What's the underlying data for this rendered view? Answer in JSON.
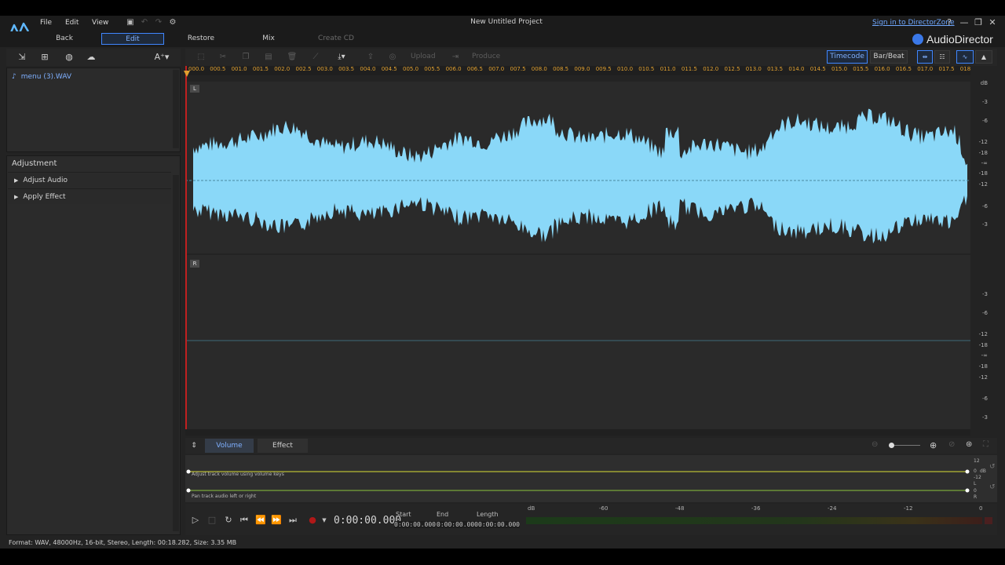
{
  "window": {
    "title": "New Untitled Project",
    "sign_in": "Sign in to DirectorZone",
    "help": "?",
    "minimize": "—",
    "restore": "❐",
    "close": "✕"
  },
  "menu": {
    "file": "File",
    "edit": "Edit",
    "view": "View"
  },
  "modes": {
    "back": "Back",
    "edit": "Edit",
    "restore": "Restore",
    "mix": "Mix",
    "create_cd": "Create CD"
  },
  "brand": {
    "name": "AudioDirector"
  },
  "left_toolbar": {
    "text_tool": "A⁺▾"
  },
  "media": {
    "items": [
      {
        "name": "menu (3).WAV"
      }
    ]
  },
  "adjustment": {
    "title": "Adjustment",
    "rows": [
      {
        "label": "Adjust Audio"
      },
      {
        "label": "Apply Effect"
      }
    ]
  },
  "editor_toolbar": {
    "upload": "Upload",
    "produce": "Produce",
    "timecode": "Timecode",
    "bar_beat": "Bar/Beat"
  },
  "ruler": {
    "labels": [
      "000.0",
      "000.5",
      "001.0",
      "001.5",
      "002.0",
      "002.5",
      "003.0",
      "003.5",
      "004.0",
      "004.5",
      "005.0",
      "005.5",
      "006.0",
      "006.5",
      "007.0",
      "007.5",
      "008.0",
      "008.5",
      "009.0",
      "009.5",
      "010.0",
      "010.5",
      "011.0",
      "011.5",
      "012.0",
      "012.5",
      "013.0",
      "013.5",
      "014.0",
      "014.5",
      "015.0",
      "015.5",
      "016.0",
      "016.5",
      "017.0",
      "017.5",
      "018.0"
    ]
  },
  "channels": {
    "left": {
      "tag": "L",
      "db_labels": [
        "dB",
        "-3",
        "-6",
        "-12",
        "-18",
        "-∞",
        "-18",
        "-12",
        "-6",
        "-3"
      ]
    },
    "right": {
      "tag": "R",
      "db_labels": [
        "-3",
        "-6",
        "-12",
        "-18",
        "-∞",
        "-18",
        "-12",
        "-6",
        "-3"
      ]
    }
  },
  "colors": {
    "waveform": "#8ad8f8",
    "accent": "#3f86ff",
    "playhead": "#c02020",
    "ruler_text": "#e0a030",
    "envelope": "#b7bb36"
  },
  "bottom_tabs": {
    "volume": "Volume",
    "effect": "Effect"
  },
  "envelopes": {
    "volume_hint": "Adjust track volume using volume keys",
    "pan_hint": "Pan track audio left or right",
    "volume_scale": [
      "12",
      "0",
      "dB",
      "-12"
    ],
    "pan_scale": [
      "L",
      "0",
      "R"
    ]
  },
  "transport": {
    "time": "0:00:00.000",
    "start_label": "Start",
    "end_label": "End",
    "length_label": "Length",
    "start_value": "0:00:00.000",
    "end_value": "0:00:00.000",
    "length_value": "0:00:00.000"
  },
  "meter": {
    "labels": [
      "dB",
      "-60",
      "-48",
      "-36",
      "-24",
      "-12",
      "0"
    ]
  },
  "status": {
    "text": "Format: WAV, 48000Hz, 16-bit, Stereo, Length: 00:18.282, Size: 3.35 MB"
  }
}
